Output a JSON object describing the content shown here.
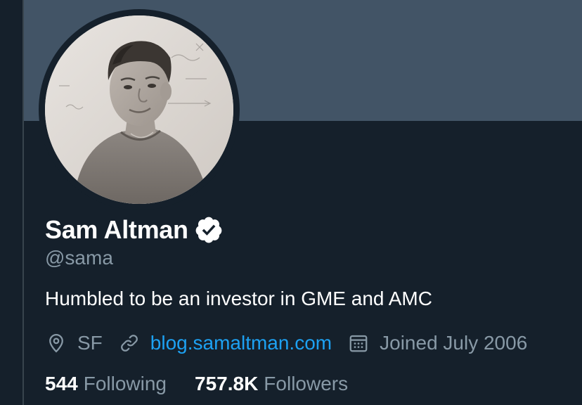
{
  "profile": {
    "display_name": "Sam Altman",
    "verified": true,
    "handle": "@sama",
    "bio": "Humbled to be an investor in GME and AMC",
    "location": "SF",
    "website": "blog.samaltman.com",
    "joined": "Joined July 2006"
  },
  "stats": {
    "following_count": "544",
    "following_label": "Following",
    "followers_count": "757.8K",
    "followers_label": "Followers"
  },
  "icons": {
    "location": "location-pin-icon",
    "website": "link-icon",
    "joined": "calendar-icon",
    "verified": "verified-badge-icon"
  },
  "colors": {
    "background": "#15202b",
    "banner": "#425466",
    "link": "#1da1f2",
    "secondary_text": "#8899a6",
    "primary_text": "#ffffff"
  }
}
